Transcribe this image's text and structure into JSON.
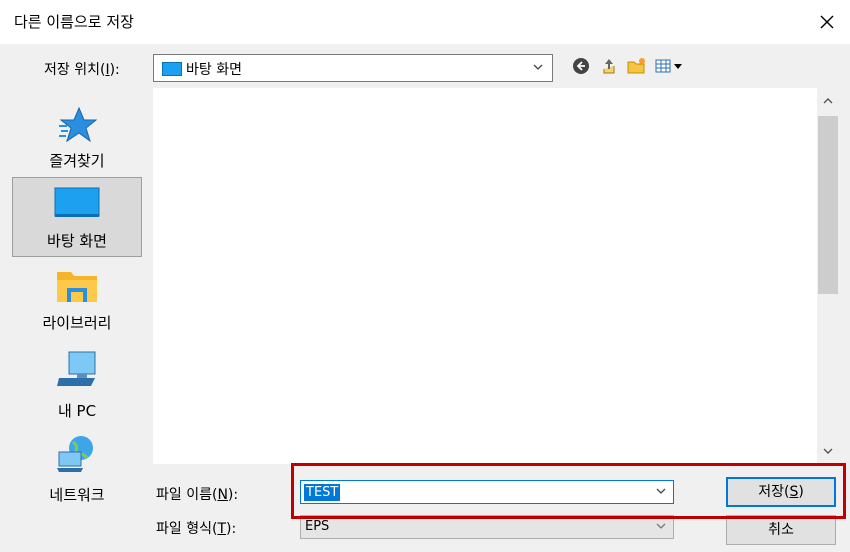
{
  "window": {
    "title": "다른 이름으로 저장"
  },
  "location": {
    "label_prefix": "저장 위치(",
    "label_key": "I",
    "label_suffix": "):",
    "value": "바탕 화면"
  },
  "toolbar": {
    "icons": [
      "back-icon",
      "up-folder-icon",
      "new-folder-icon",
      "view-menu-icon"
    ]
  },
  "places": [
    {
      "id": "favorites",
      "label": "즐겨찾기",
      "icon": "star-icon"
    },
    {
      "id": "desktop",
      "label": "바탕 화면",
      "icon": "desktop-icon",
      "selected": true
    },
    {
      "id": "libraries",
      "label": "라이브러리",
      "icon": "library-folder-icon"
    },
    {
      "id": "this-pc",
      "label": "내 PC",
      "icon": "computer-icon"
    },
    {
      "id": "network",
      "label": "네트워크",
      "icon": "network-icon"
    }
  ],
  "file_name": {
    "label_prefix": "파일 이름(",
    "label_key": "N",
    "label_suffix": "):",
    "value": "TEST"
  },
  "file_type": {
    "label_prefix": "파일 형식(",
    "label_key": "T",
    "label_suffix": "):",
    "value": "EPS"
  },
  "buttons": {
    "save_prefix": "저장(",
    "save_key": "S",
    "save_suffix": ")",
    "cancel": "취소"
  },
  "colors": {
    "accent": "#0078d7",
    "highlight": "#c00000",
    "desktop_icon": "#1ea0f0"
  }
}
